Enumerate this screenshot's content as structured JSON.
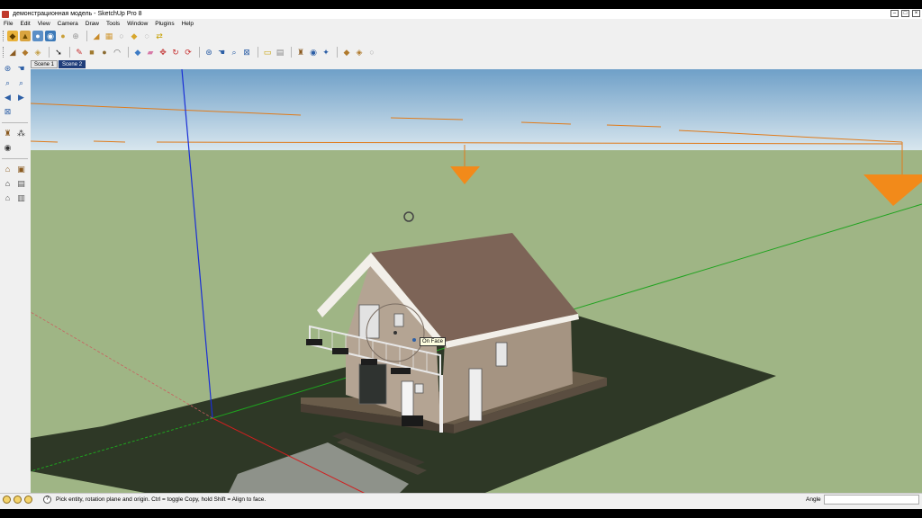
{
  "window": {
    "title": "демонстрационная модель - SketchUp Pro 8"
  },
  "menu": [
    "File",
    "Edit",
    "View",
    "Camera",
    "Draw",
    "Tools",
    "Window",
    "Plugins",
    "Help"
  ],
  "toolbar_row1": [
    "get-models-icon",
    "share-model-icon",
    "share-component-icon",
    "google-earth-icon",
    "toggle-terrain-icon",
    "geo-location-icon",
    "sandbox-from-contours-icon",
    "sandbox-from-scratch-icon",
    "smoove-icon",
    "stamp-icon",
    "drape-icon",
    "flip-edge-icon"
  ],
  "toolbar_row2": [
    "select-icon",
    "pencil-icon",
    "rectangle-icon",
    "circle-icon",
    "arc-icon",
    "push-pull-icon",
    "eraser-icon",
    "paint-bucket-icon",
    "move-icon",
    "rotate-icon",
    "follow-me-icon",
    "orbit-icon",
    "pan-icon",
    "zoom-icon",
    "zoom-extents-icon",
    "tape-measure-icon",
    "text-icon",
    "section-plane-icon",
    "axes-icon",
    "dimension-icon",
    "walk-icon",
    "position-camera-icon",
    "look-around-icon"
  ],
  "scenes": [
    "Scene 1",
    "Scene 2"
  ],
  "scene_active": 1,
  "viewport": {
    "inference_tooltip": "On Face"
  },
  "status": {
    "hint": "Pick entity, rotation plane and origin.  Ctrl = toggle Copy, hold Shift = Align to face.",
    "vcb_label": "Angle",
    "vcb_value": ""
  },
  "colors": {
    "sky_top": "#6fa0c8",
    "sky_bottom": "#d8e6ee",
    "ground": "#9fb585",
    "lot": "#2e3826",
    "roof": "#7d6457",
    "wall": "#b4a493",
    "axis_red": "#d11f1f",
    "axis_green": "#1fa31f",
    "axis_blue": "#1a2fd6",
    "scene_tab_active": "#1f3d7a"
  }
}
